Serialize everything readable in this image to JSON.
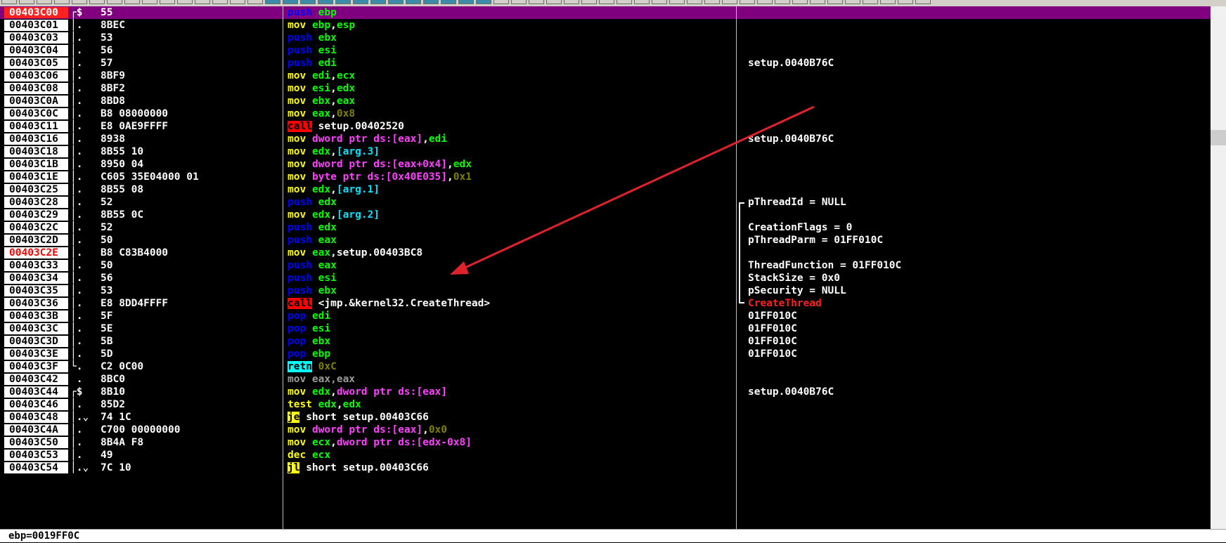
{
  "colors": {
    "selected_row_bg": "#800080",
    "address_bg": "#ffffff",
    "current_eip_bg": "#ff2020",
    "mnemonic_push_pop": "#0000ff",
    "mnemonic_mov": "#ffff00",
    "operand_register": "#00ff00",
    "operand_memory": "#ff40ff",
    "operand_number": "#808000",
    "call_bg": "#ff0000",
    "jump_bg": "#ffff00",
    "ret_bg": "#00ffff",
    "api_comment": "#ff2020",
    "annotation_arrow": "#e0232a"
  },
  "disassembly": {
    "rows": [
      {
        "address": "00403C00",
        "bracket": "┌$",
        "hex": "55",
        "instruction": [
          {
            "t": "push",
            "k": "mpush"
          },
          {
            "t": " "
          },
          {
            "t": "ebp",
            "k": "reg"
          }
        ],
        "comment": ""
      },
      {
        "address": "00403C01",
        "bracket": "│.",
        "hex": "8BEC",
        "instruction": [
          {
            "t": "mov",
            "k": "mmov"
          },
          {
            "t": " "
          },
          {
            "t": "ebp",
            "k": "reg"
          },
          {
            "t": ","
          },
          {
            "t": "esp",
            "k": "reg"
          }
        ],
        "comment": ""
      },
      {
        "address": "00403C03",
        "bracket": "│.",
        "hex": "53",
        "instruction": [
          {
            "t": "push",
            "k": "mpush"
          },
          {
            "t": " "
          },
          {
            "t": "ebx",
            "k": "reg"
          }
        ],
        "comment": ""
      },
      {
        "address": "00403C04",
        "bracket": "│.",
        "hex": "56",
        "instruction": [
          {
            "t": "push",
            "k": "mpush"
          },
          {
            "t": " "
          },
          {
            "t": "esi",
            "k": "reg"
          }
        ],
        "comment": ""
      },
      {
        "address": "00403C05",
        "bracket": "│.",
        "hex": "57",
        "instruction": [
          {
            "t": "push",
            "k": "mpush"
          },
          {
            "t": " "
          },
          {
            "t": "edi",
            "k": "reg"
          }
        ],
        "comment": "setup.0040B76C"
      },
      {
        "address": "00403C06",
        "bracket": "│.",
        "hex": "8BF9",
        "instruction": [
          {
            "t": "mov",
            "k": "mmov"
          },
          {
            "t": " "
          },
          {
            "t": "edi",
            "k": "reg"
          },
          {
            "t": ","
          },
          {
            "t": "ecx",
            "k": "reg"
          }
        ],
        "comment": ""
      },
      {
        "address": "00403C08",
        "bracket": "│.",
        "hex": "8BF2",
        "instruction": [
          {
            "t": "mov",
            "k": "mmov"
          },
          {
            "t": " "
          },
          {
            "t": "esi",
            "k": "reg"
          },
          {
            "t": ","
          },
          {
            "t": "edx",
            "k": "reg"
          }
        ],
        "comment": ""
      },
      {
        "address": "00403C0A",
        "bracket": "│.",
        "hex": "8BD8",
        "instruction": [
          {
            "t": "mov",
            "k": "mmov"
          },
          {
            "t": " "
          },
          {
            "t": "ebx",
            "k": "reg"
          },
          {
            "t": ","
          },
          {
            "t": "eax",
            "k": "reg"
          }
        ],
        "comment": ""
      },
      {
        "address": "00403C0C",
        "bracket": "│.",
        "hex": "B8 08000000",
        "instruction": [
          {
            "t": "mov",
            "k": "mmov"
          },
          {
            "t": " "
          },
          {
            "t": "eax",
            "k": "reg"
          },
          {
            "t": ","
          },
          {
            "t": "0x8",
            "k": "num"
          }
        ],
        "comment": ""
      },
      {
        "address": "00403C11",
        "bracket": "│.",
        "hex": "E8 0AE9FFFF",
        "instruction": [
          {
            "t": "call",
            "k": "call"
          },
          {
            "t": " setup.00402520"
          }
        ],
        "comment": ""
      },
      {
        "address": "00403C16",
        "bracket": "│.",
        "hex": "8938",
        "instruction": [
          {
            "t": "mov",
            "k": "mmov"
          },
          {
            "t": " "
          },
          {
            "t": "dword ptr ds:[eax]",
            "k": "mem"
          },
          {
            "t": ","
          },
          {
            "t": "edi",
            "k": "reg"
          }
        ],
        "comment": "setup.0040B76C"
      },
      {
        "address": "00403C18",
        "bracket": "│.",
        "hex": "8B55 10",
        "instruction": [
          {
            "t": "mov",
            "k": "mmov"
          },
          {
            "t": " "
          },
          {
            "t": "edx",
            "k": "reg"
          },
          {
            "t": ","
          },
          {
            "t": "[arg.3]",
            "k": "arg"
          }
        ],
        "comment": ""
      },
      {
        "address": "00403C1B",
        "bracket": "│.",
        "hex": "8950 04",
        "instruction": [
          {
            "t": "mov",
            "k": "mmov"
          },
          {
            "t": " "
          },
          {
            "t": "dword ptr ds:[eax+0x4]",
            "k": "mem"
          },
          {
            "t": ","
          },
          {
            "t": "edx",
            "k": "reg"
          }
        ],
        "comment": ""
      },
      {
        "address": "00403C1E",
        "bracket": "│.",
        "hex": "C605 35E04000 01",
        "instruction": [
          {
            "t": "mov",
            "k": "mmov"
          },
          {
            "t": " "
          },
          {
            "t": "byte ptr ds:[0x40E035]",
            "k": "mem"
          },
          {
            "t": ","
          },
          {
            "t": "0x1",
            "k": "num"
          }
        ],
        "comment": ""
      },
      {
        "address": "00403C25",
        "bracket": "│.",
        "hex": "8B55 08",
        "instruction": [
          {
            "t": "mov",
            "k": "mmov"
          },
          {
            "t": " "
          },
          {
            "t": "edx",
            "k": "reg"
          },
          {
            "t": ","
          },
          {
            "t": "[arg.1]",
            "k": "arg"
          }
        ],
        "comment": ""
      },
      {
        "address": "00403C28",
        "bracket": "│.",
        "hex": "52",
        "instruction": [
          {
            "t": "push",
            "k": "mpush"
          },
          {
            "t": " "
          },
          {
            "t": "edx",
            "k": "reg"
          }
        ],
        "comment": "pThreadId = NULL"
      },
      {
        "address": "00403C29",
        "bracket": "│.",
        "hex": "8B55 0C",
        "instruction": [
          {
            "t": "mov",
            "k": "mmov"
          },
          {
            "t": " "
          },
          {
            "t": "edx",
            "k": "reg"
          },
          {
            "t": ","
          },
          {
            "t": "[arg.2]",
            "k": "arg"
          }
        ],
        "comment": ""
      },
      {
        "address": "00403C2C",
        "bracket": "│.",
        "hex": "52",
        "instruction": [
          {
            "t": "push",
            "k": "mpush"
          },
          {
            "t": " "
          },
          {
            "t": "edx",
            "k": "reg"
          }
        ],
        "comment": "CreationFlags = 0"
      },
      {
        "address": "00403C2D",
        "bracket": "│.",
        "hex": "50",
        "instruction": [
          {
            "t": "push",
            "k": "mpush"
          },
          {
            "t": " "
          },
          {
            "t": "eax",
            "k": "reg"
          }
        ],
        "comment": "pThreadParm = 01FF010C"
      },
      {
        "address": "00403C2E",
        "bracket": "│.",
        "hex": "B8 C83B4000",
        "instruction": [
          {
            "t": "mov",
            "k": "mmov"
          },
          {
            "t": " "
          },
          {
            "t": "eax",
            "k": "reg"
          },
          {
            "t": ",setup.00403BC8"
          }
        ],
        "comment": ""
      },
      {
        "address": "00403C33",
        "bracket": "│.",
        "hex": "50",
        "instruction": [
          {
            "t": "push",
            "k": "mpush"
          },
          {
            "t": " "
          },
          {
            "t": "eax",
            "k": "reg"
          }
        ],
        "comment": "ThreadFunction = 01FF010C"
      },
      {
        "address": "00403C34",
        "bracket": "│.",
        "hex": "56",
        "instruction": [
          {
            "t": "push",
            "k": "mpush"
          },
          {
            "t": " "
          },
          {
            "t": "esi",
            "k": "reg"
          }
        ],
        "comment": "StackSize = 0x0"
      },
      {
        "address": "00403C35",
        "bracket": "│.",
        "hex": "53",
        "instruction": [
          {
            "t": "push",
            "k": "mpush"
          },
          {
            "t": " "
          },
          {
            "t": "ebx",
            "k": "reg"
          }
        ],
        "comment": "pSecurity = NULL"
      },
      {
        "address": "00403C36",
        "bracket": "│.",
        "hex": "E8 8DD4FFFF",
        "instruction": [
          {
            "t": "call",
            "k": "call"
          },
          {
            "t": " <jmp.&kernel32.CreateThread>"
          }
        ],
        "comment": "CreateThread"
      },
      {
        "address": "00403C3B",
        "bracket": "│.",
        "hex": "5F",
        "instruction": [
          {
            "t": "pop",
            "k": "mpush"
          },
          {
            "t": " "
          },
          {
            "t": "edi",
            "k": "reg"
          }
        ],
        "comment": "01FF010C"
      },
      {
        "address": "00403C3C",
        "bracket": "│.",
        "hex": "5E",
        "instruction": [
          {
            "t": "pop",
            "k": "mpush"
          },
          {
            "t": " "
          },
          {
            "t": "esi",
            "k": "reg"
          }
        ],
        "comment": "01FF010C"
      },
      {
        "address": "00403C3D",
        "bracket": "│.",
        "hex": "5B",
        "instruction": [
          {
            "t": "pop",
            "k": "mpush"
          },
          {
            "t": " "
          },
          {
            "t": "ebx",
            "k": "reg"
          }
        ],
        "comment": "01FF010C"
      },
      {
        "address": "00403C3E",
        "bracket": "│.",
        "hex": "5D",
        "instruction": [
          {
            "t": "pop",
            "k": "mpush"
          },
          {
            "t": " "
          },
          {
            "t": "ebp",
            "k": "reg"
          }
        ],
        "comment": "01FF010C"
      },
      {
        "address": "00403C3F",
        "bracket": "└.",
        "hex": "C2 0C00",
        "instruction": [
          {
            "t": "retn",
            "k": "ret"
          },
          {
            "t": " "
          },
          {
            "t": "0xC",
            "k": "num"
          }
        ],
        "comment": ""
      },
      {
        "address": "00403C42",
        "bracket": " .",
        "hex": "8BC0",
        "instruction": [
          {
            "t": "mov eax,eax",
            "k": "gray"
          }
        ],
        "comment": ""
      },
      {
        "address": "00403C44",
        "bracket": "┌$",
        "hex": "8B10",
        "instruction": [
          {
            "t": "mov",
            "k": "mmov"
          },
          {
            "t": " "
          },
          {
            "t": "edx",
            "k": "reg"
          },
          {
            "t": ","
          },
          {
            "t": "dword ptr ds:[eax]",
            "k": "mem"
          }
        ],
        "comment": "setup.0040B76C"
      },
      {
        "address": "00403C46",
        "bracket": "│.",
        "hex": "85D2",
        "instruction": [
          {
            "t": "test",
            "k": "mmov"
          },
          {
            "t": " "
          },
          {
            "t": "edx",
            "k": "reg"
          },
          {
            "t": ","
          },
          {
            "t": "edx",
            "k": "reg"
          }
        ],
        "comment": ""
      },
      {
        "address": "00403C48",
        "bracket": "│.⌄",
        "hex": "74 1C",
        "instruction": [
          {
            "t": "je",
            "k": "jmp"
          },
          {
            "t": " short setup.00403C66"
          }
        ],
        "comment": ""
      },
      {
        "address": "00403C4A",
        "bracket": "│.",
        "hex": "C700 00000000",
        "instruction": [
          {
            "t": "mov",
            "k": "mmov"
          },
          {
            "t": " "
          },
          {
            "t": "dword ptr ds:[eax]",
            "k": "mem"
          },
          {
            "t": ","
          },
          {
            "t": "0x0",
            "k": "num"
          }
        ],
        "comment": ""
      },
      {
        "address": "00403C50",
        "bracket": "│.",
        "hex": "8B4A F8",
        "instruction": [
          {
            "t": "mov",
            "k": "mmov"
          },
          {
            "t": " "
          },
          {
            "t": "ecx",
            "k": "reg"
          },
          {
            "t": ","
          },
          {
            "t": "dword ptr ds:[edx-0x8]",
            "k": "mem"
          }
        ],
        "comment": ""
      },
      {
        "address": "00403C53",
        "bracket": "│.",
        "hex": "49",
        "instruction": [
          {
            "t": "dec",
            "k": "mmov"
          },
          {
            "t": " "
          },
          {
            "t": "ecx",
            "k": "reg"
          }
        ],
        "comment": ""
      },
      {
        "address": "00403C54",
        "bracket": "│.⌄",
        "hex": "7C 10",
        "instruction": [
          {
            "t": "jl",
            "k": "jmp"
          },
          {
            "t": " short setup.00403C66"
          }
        ],
        "comment": ""
      }
    ]
  },
  "status_bar": {
    "text": "ebp=0019FF0C"
  }
}
